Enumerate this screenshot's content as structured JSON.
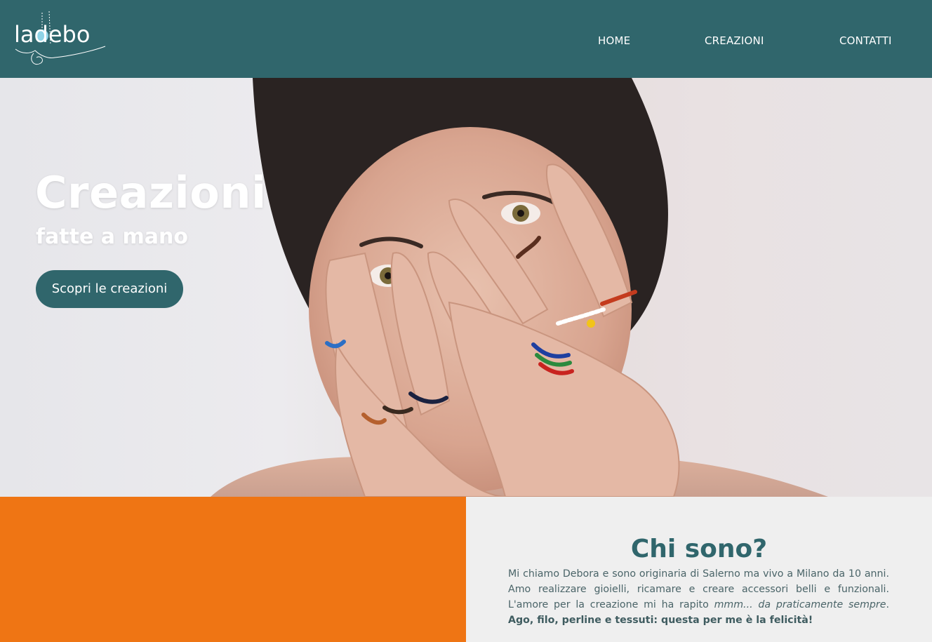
{
  "header": {
    "logo_text": "ladebo",
    "bg_color": "#30666c",
    "nav": [
      {
        "label": "HOME"
      },
      {
        "label": "CREAZIONI"
      },
      {
        "label": "CONTATTI"
      }
    ]
  },
  "hero": {
    "title": "Creazioni",
    "subtitle": "fatte a mano",
    "cta_label": "Scopri le creazioni",
    "image_description_icon": "woman-with-handmade-rings-photo"
  },
  "about": {
    "title": "Chi sono?",
    "text_part1": "Mi chiamo Debora e sono originaria di Salerno ma vivo a Milano da 10 anni. Amo realizzare gioielli, ricamare e creare accessori belli e funzionali. L'amore per la creazione mi ha rapito ",
    "text_italic": "mmm... da praticamente sempre",
    "text_part2": ". ",
    "text_bold": "Ago, filo, perline e tessuti: questa per me è la felicità!",
    "accent_color": "#ef7514",
    "bg_color": "#efefef"
  }
}
